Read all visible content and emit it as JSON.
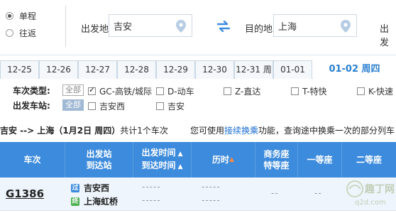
{
  "trip": {
    "one_way": "单程",
    "round_trip": "往返"
  },
  "search": {
    "from_label": "出发地",
    "from_value": "吉安",
    "to_label": "目的地",
    "to_value": "上海",
    "date_label": "出发"
  },
  "dates": {
    "tabs": [
      "12-25",
      "12-26",
      "12-27",
      "12-28",
      "12-29",
      "12-30",
      "12-31 周",
      "01-01"
    ],
    "active": "01-02 周四"
  },
  "filters": {
    "type_label": "车次类型:",
    "station_label": "出发车站:",
    "all_label": "全部",
    "types": [
      "GC-高铁/城际",
      "D-动车",
      "Z-直达",
      "T-特快",
      "K-快速"
    ],
    "stations": [
      "吉安西",
      "吉安"
    ]
  },
  "summary": {
    "route": "吉安 --> 上海（1月2日 周四）",
    "count": "共计1个车次",
    "note_prefix": "您可使用",
    "note_link": "接续换乘",
    "note_suffix": "功能，查询途中换乘一次的部分列车"
  },
  "table": {
    "headers": {
      "train": "车次",
      "stations_1": "出发站",
      "stations_2": "到达站",
      "times_1": "出发时间",
      "times_2": "到达时间",
      "duration": "历时",
      "business_1": "商务座",
      "business_2": "特等座",
      "first": "一等座",
      "second": "二等座"
    },
    "row": {
      "train_no": "G1386",
      "from_badge": "过",
      "from_station": "吉安西",
      "to_badge": "终",
      "to_station": "上海虹桥",
      "from_time": "-----",
      "to_time": "-----",
      "dur_1": "-----",
      "dur_2": "-----",
      "business": "--",
      "first": "--"
    }
  },
  "watermark": {
    "line1": "趣丁网",
    "line2": "q2d.com"
  },
  "colors": {
    "accent": "#3d8bdc",
    "active_date": "#2a7fd0",
    "link": "#1b6ed0",
    "from_badge": "#3d8bdc",
    "to_badge": "#4caf50"
  }
}
